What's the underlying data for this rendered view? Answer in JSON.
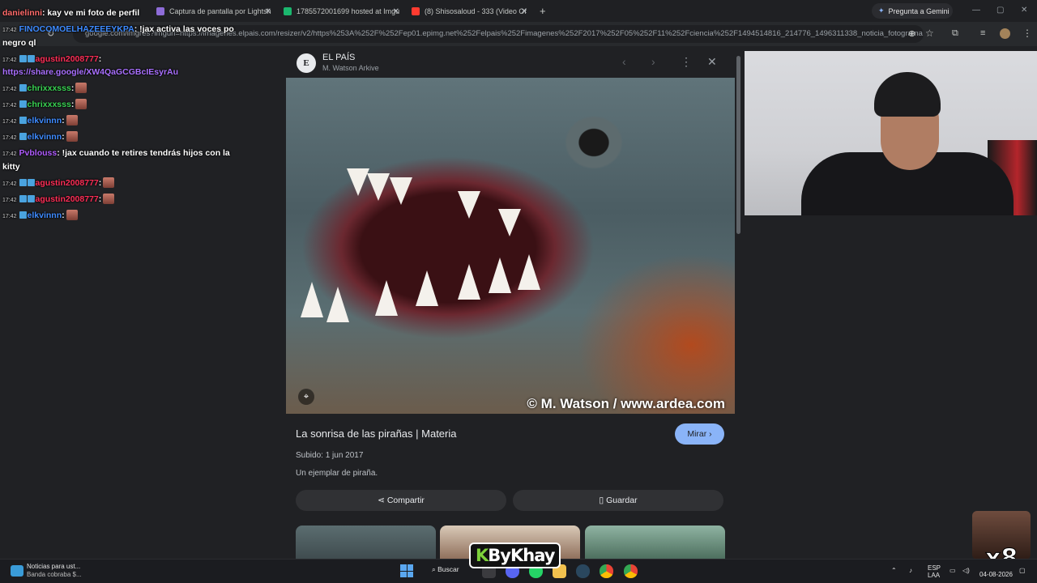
{
  "tabs": [
    {
      "label": "Captura de pantalla por Lightsh",
      "color": "#8e6cd8"
    },
    {
      "label": "1785572001699 hosted at Imgu",
      "color": "#1bb76e"
    },
    {
      "label": "(8) Shisosaloud - 333 (Video Of",
      "color": "#ff3b30"
    }
  ],
  "gemini_button": "Pregunta a Gemini",
  "address_bar": "google.com/imgres?imgurl=https://imagenes.elpais.com/resizer/v2/https%253A%252F%252Fep01.epimg.net%252Felpais%252Fimagenes%252F2017%252F05%252F11%252Fciencia%252F1494514816_214776_1496311338_noticia_fotograma.jp...",
  "chat": [
    {
      "time": "",
      "user": "danielinni",
      "color": "#ff6b6b",
      "text": ": kay ve mi foto de perfil",
      "emote": false,
      "badges": 0
    },
    {
      "time": "17:42",
      "user": "FINOCOMOELHAZEEEYKPA",
      "color": "#3e8bff",
      "text": ": !jax activa las voces po",
      "emote": false,
      "badges": 0
    },
    {
      "time": "",
      "user": "",
      "color": "#ffffff",
      "text": "negro ql",
      "emote": false,
      "badges": 0
    },
    {
      "time": "17:42",
      "user": "agustin2008777",
      "color": "#ff2e57",
      "text": ":",
      "emote": false,
      "badges": 2
    },
    {
      "time": "",
      "user": "",
      "color": "#a970ff",
      "text": "https://share.google/XW4QaGCGBcIEsyrAu",
      "emote": false,
      "badges": 0
    },
    {
      "time": "17:42",
      "user": "chrixxxsss",
      "color": "#39d353",
      "text": ":",
      "emote": true,
      "badges": 1
    },
    {
      "time": "17:42",
      "user": "chrixxxsss",
      "color": "#39d353",
      "text": ":",
      "emote": true,
      "badges": 1
    },
    {
      "time": "17:42",
      "user": "elkvinnn",
      "color": "#3e8bff",
      "text": ":",
      "emote": true,
      "badges": 1
    },
    {
      "time": "17:42",
      "user": "elkvinnn",
      "color": "#3e8bff",
      "text": ":",
      "emote": true,
      "badges": 1
    },
    {
      "time": "17:42",
      "user": "Pvblouss",
      "color": "#b05cff",
      "text": ": !jax cuando te retires tendrás hijos con la",
      "emote": false,
      "badges": 0
    },
    {
      "time": "",
      "user": "",
      "color": "#ffffff",
      "text": "kitty",
      "emote": false,
      "badges": 0
    },
    {
      "time": "17:42",
      "user": "agustin2008777",
      "color": "#ff2e57",
      "text": ":",
      "emote": true,
      "badges": 2
    },
    {
      "time": "17:42",
      "user": "agustin2008777",
      "color": "#ff2e57",
      "text": ":",
      "emote": true,
      "badges": 2
    },
    {
      "time": "17:42",
      "user": "elkvinnn",
      "color": "#3e8bff",
      "text": ":",
      "emote": true,
      "badges": 1
    }
  ],
  "viewer": {
    "source_initial": "E",
    "source_name": "EL PAÍS",
    "source_sub": "M. Watson Arkive",
    "watermark": "© M. Watson / www.ardea.com",
    "title": "La sonrisa de las pirañas | Materia",
    "visit_label": "Mirar ›",
    "uploaded": "Subido: 1 jun 2017",
    "description": "Un ejemplar de piraña.",
    "share_label": "Compartir",
    "save_label": "Guardar"
  },
  "overlay": {
    "brand": "ByKhay",
    "brand_prefix": "K",
    "multiplier": "x8"
  },
  "taskbar": {
    "news_title": "Noticias para ust...",
    "news_sub": "Banda cobraba $...",
    "search": "Buscar",
    "lang": "ESP",
    "lang_sub": "LAA",
    "date": "04-08-2026"
  }
}
